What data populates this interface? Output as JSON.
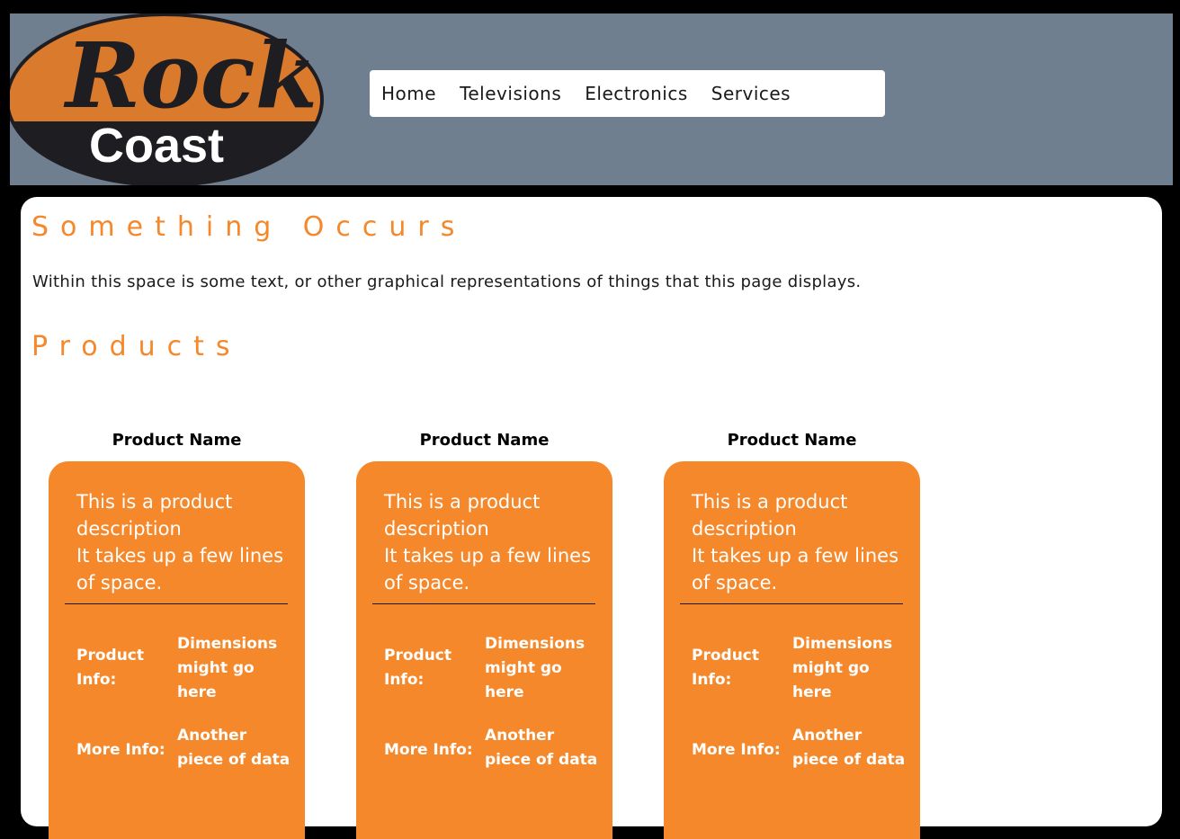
{
  "logo": {
    "word1": "Rock",
    "word2": "Coast",
    "colors": {
      "orange": "#d97a2c",
      "dark": "#1e1d22"
    }
  },
  "nav": {
    "items": [
      {
        "label": "Home"
      },
      {
        "label": "Televisions"
      },
      {
        "label": "Electronics"
      },
      {
        "label": "Services"
      }
    ]
  },
  "main": {
    "heading": "Something Occurs",
    "intro": "Within this space is some text, or other graphical representations of things that this page displays.",
    "products_heading": "Products"
  },
  "products": [
    {
      "name": "Product Name",
      "desc_line1": "This is a product description",
      "desc_line2": "It takes up a few lines of space.",
      "info_label": "Product Info:",
      "info_value": "Dimensions might go here",
      "more_label": "More Info:",
      "more_value": "Another piece of data"
    },
    {
      "name": "Product Name",
      "desc_line1": "This is a product description",
      "desc_line2": "It takes up a few lines of space.",
      "info_label": "Product Info:",
      "info_value": "Dimensions might go here",
      "more_label": "More Info:",
      "more_value": "Another piece of data"
    },
    {
      "name": "Product Name",
      "desc_line1": "This is a product description",
      "desc_line2": "It takes up a few lines of space.",
      "info_label": "Product Info:",
      "info_value": "Dimensions might go here",
      "more_label": "More Info:",
      "more_value": "Another piece of data"
    }
  ],
  "colors": {
    "accent": "#f5882a",
    "header": "#6f7f90",
    "background": "#000000"
  }
}
